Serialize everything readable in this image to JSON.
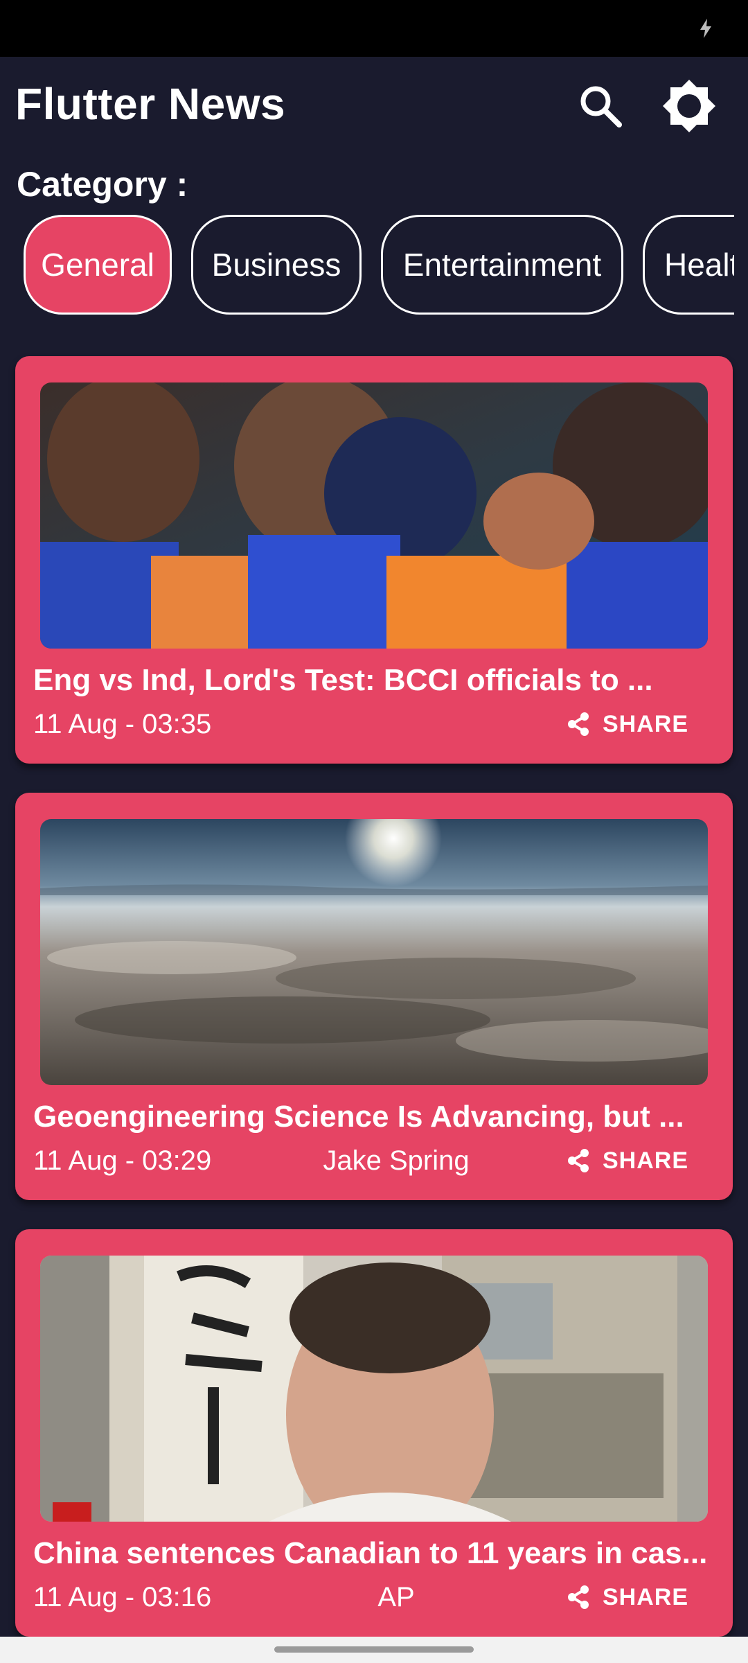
{
  "app": {
    "title": "Flutter News"
  },
  "colors": {
    "background": "#1a1b2e",
    "accent": "#e64464",
    "text": "#ffffff"
  },
  "header": {
    "search_icon": "search-icon",
    "theme_icon": "brightness-icon"
  },
  "category": {
    "label": "Category :",
    "chips": [
      "General",
      "Business",
      "Entertainment",
      "Health"
    ],
    "selected": "General"
  },
  "articles": [
    {
      "title": "Eng vs Ind, Lord's Test: BCCI officials to ...",
      "date": "11 Aug - 03:35",
      "source": "",
      "share_label": "SHARE"
    },
    {
      "title": "Geoengineering Science Is Advancing, but ...",
      "date": "11 Aug - 03:29",
      "source": "Jake Spring",
      "share_label": "SHARE"
    },
    {
      "title": "China sentences Canadian to 11 years in cas...",
      "date": "11 Aug - 03:16",
      "source": "AP",
      "share_label": "SHARE"
    }
  ]
}
